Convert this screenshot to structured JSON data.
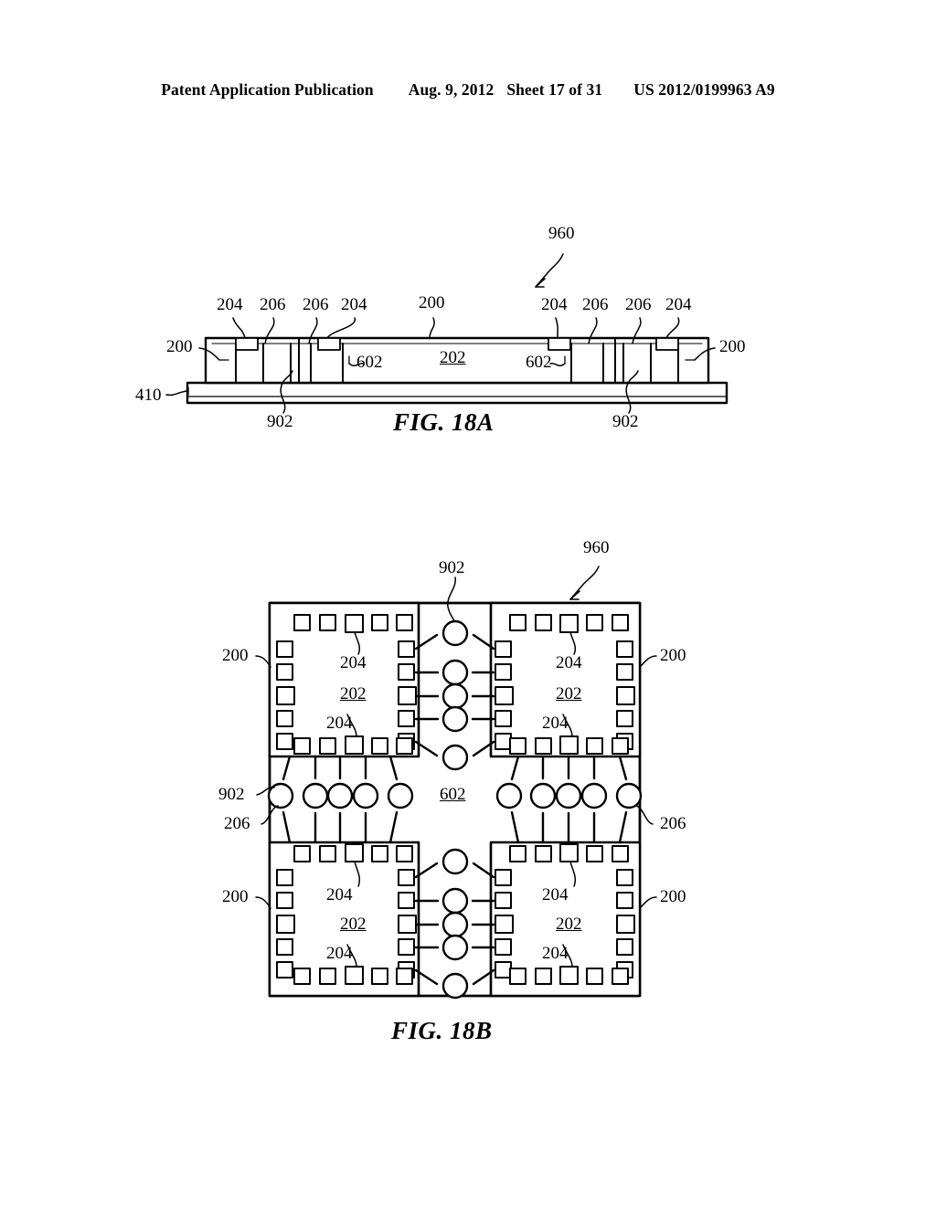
{
  "header": {
    "publication": "Patent Application Publication",
    "date": "Aug. 9, 2012",
    "sheet": "Sheet 17 of 31",
    "number": "US 2012/0199963 A9"
  },
  "figures": [
    {
      "id": "fig-18a",
      "caption": "FIG. 18A",
      "assembly_ref": "960",
      "labels": {
        "die_body": "202",
        "package": "200",
        "pad": "204",
        "interconnect": "206",
        "gap": "602",
        "via": "902",
        "substrate": "410"
      },
      "callouts_top_left": [
        "204",
        "206",
        "206",
        "204"
      ],
      "callouts_top_center": [
        "200"
      ],
      "callouts_top_right": [
        "204",
        "206",
        "206",
        "204"
      ],
      "callouts_side": [
        "200",
        "200"
      ],
      "callouts_inner": [
        "602",
        "202",
        "602"
      ],
      "callouts_bottom": [
        "410",
        "902",
        "902"
      ]
    },
    {
      "id": "fig-18b",
      "caption": "FIG. 18B",
      "assembly_ref": "960",
      "labels": {
        "die_body": "202",
        "package": "200",
        "pad": "204",
        "interconnect": "206",
        "center_gap": "602",
        "via": "902"
      },
      "quadrants": [
        {
          "name": "top-left",
          "die": "202",
          "pad_upper": "204",
          "pad_lower": "204"
        },
        {
          "name": "top-right",
          "die": "202",
          "pad_upper": "204",
          "pad_lower": "204"
        },
        {
          "name": "bottom-left",
          "die": "202",
          "pad_upper": "204",
          "pad_lower": "204"
        },
        {
          "name": "bottom-right",
          "die": "202",
          "pad_upper": "204",
          "pad_lower": "204"
        }
      ],
      "edge_callouts": {
        "left_top": "200",
        "left_via": "902",
        "left_interconnect": "206",
        "left_bottom": "200",
        "right_top": "200",
        "right_interconnect": "206",
        "right_bottom": "200",
        "top_via": "902",
        "center": "602"
      },
      "pads_per_side": 5,
      "vias_per_channel": 5
    }
  ]
}
